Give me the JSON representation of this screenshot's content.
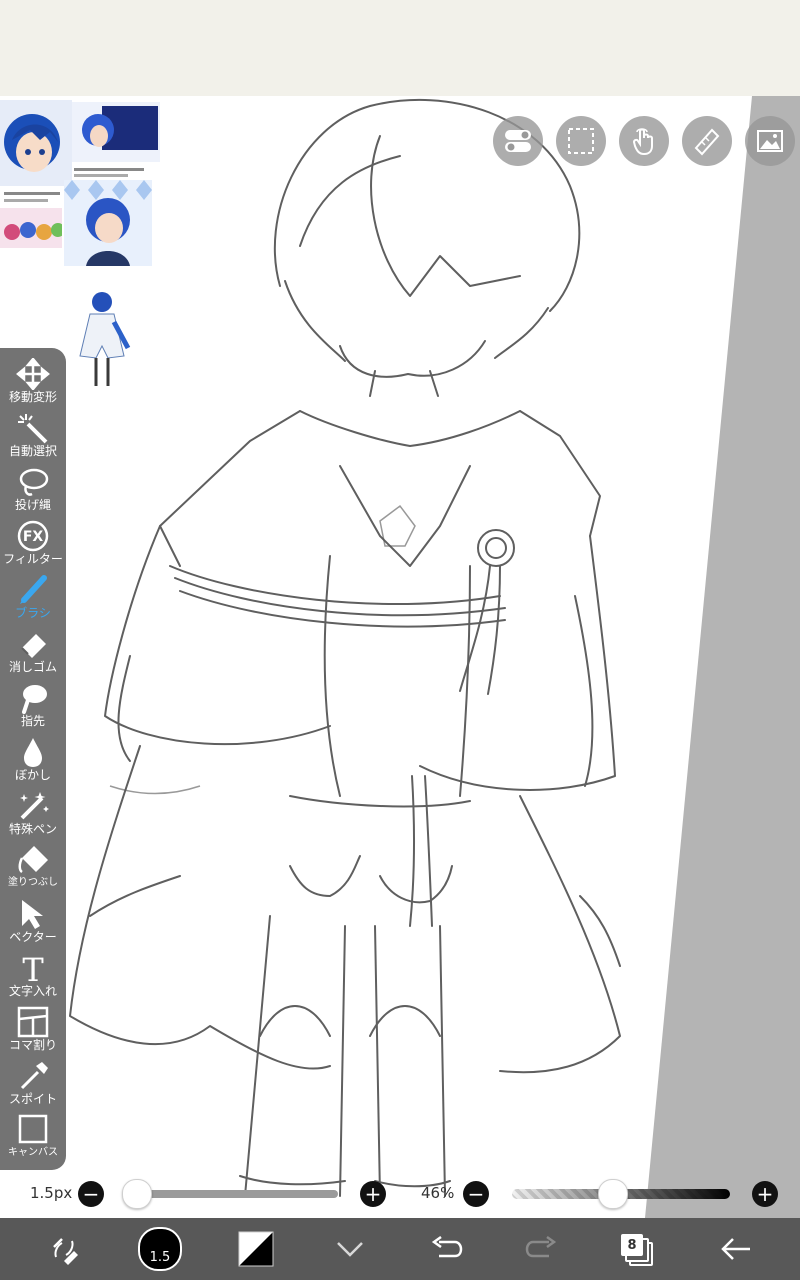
{
  "tools": [
    {
      "id": "move",
      "label": "移動変形",
      "icon": "move-arrows-icon"
    },
    {
      "id": "magic",
      "label": "自動選択",
      "icon": "magic-wand-icon"
    },
    {
      "id": "lasso",
      "label": "投げ縄",
      "icon": "lasso-icon"
    },
    {
      "id": "filter",
      "label": "フィルター",
      "icon": "fx-icon"
    },
    {
      "id": "brush",
      "label": "ブラシ",
      "icon": "brush-icon",
      "active": true
    },
    {
      "id": "eraser",
      "label": "消しゴム",
      "icon": "eraser-icon"
    },
    {
      "id": "smudge",
      "label": "指先",
      "icon": "smudge-icon"
    },
    {
      "id": "blur",
      "label": "ぼかし",
      "icon": "blur-drop-icon"
    },
    {
      "id": "special",
      "label": "特殊ペン",
      "icon": "special-pen-icon"
    },
    {
      "id": "fill",
      "label": "塗りつぶし",
      "icon": "bucket-icon"
    },
    {
      "id": "vector",
      "label": "ベクター",
      "icon": "vector-arrow-icon"
    },
    {
      "id": "text",
      "label": "文字入れ",
      "icon": "text-t-icon"
    },
    {
      "id": "frame",
      "label": "コマ割り",
      "icon": "frame-divider-icon"
    },
    {
      "id": "eyedropper",
      "label": "スポイト",
      "icon": "eyedropper-icon"
    },
    {
      "id": "canvas",
      "label": "キャンバス",
      "icon": "canvas-square-icon"
    }
  ],
  "controls": {
    "brush_size": "1.5px",
    "brush_size_fraction": 0.0,
    "opacity": "46%",
    "opacity_fraction": 0.46
  },
  "bottom": {
    "brush_badge": "1.5",
    "layers_count": "8"
  },
  "colors": {
    "accent": "#3aa7ef",
    "topbar": "#f2f1ea",
    "toolbar": "#585858",
    "panel": "#606060"
  }
}
